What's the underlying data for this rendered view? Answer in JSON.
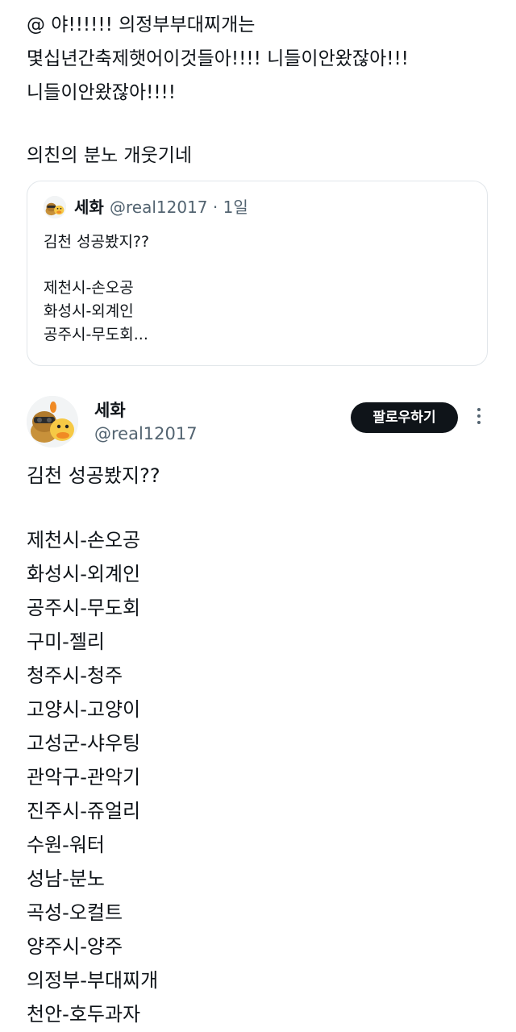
{
  "reply": {
    "lines": [
      "@ 야!!!!!! 의정부부대찌개는",
      "몇십년간축제햇어이것들아!!!! 니들이안왔잖아!!!",
      "니들이안왔잖아!!!!"
    ],
    "comment": "의친의 분노 개웃기네"
  },
  "quote": {
    "author_name": "세화",
    "author_handle_time": "@real12017 · 1일",
    "avatar_icon": "cartoon-avatar-icon",
    "lines": [
      "김천 성공봤지??",
      "제천시-손오공",
      "화성시-외계인",
      "공주시-무도회..."
    ]
  },
  "post": {
    "author_name": "세화",
    "author_handle": "@real12017",
    "avatar_icon": "cartoon-avatar-icon",
    "follow_label": "팔로우하기",
    "more_icon": "more-options-icon",
    "lines": [
      "김천 성공봤지??",
      "제천시-손오공",
      "화성시-외계인",
      "공주시-무도회",
      "구미-젤리",
      "청주시-청주",
      "고양시-고양이",
      "고성군-샤우팅",
      "관악구-관악기",
      "진주시-쥬얼리",
      "수원-워터",
      "성남-분노",
      "곡성-오컬트",
      "양주시-양주",
      "의정부-부대찌개",
      "천안-호두과자"
    ]
  },
  "colors": {
    "text": "#0f1419",
    "secondary_text": "#536471",
    "border": "#e1e6ea",
    "button_bg": "#0f1419",
    "button_text": "#ffffff"
  }
}
